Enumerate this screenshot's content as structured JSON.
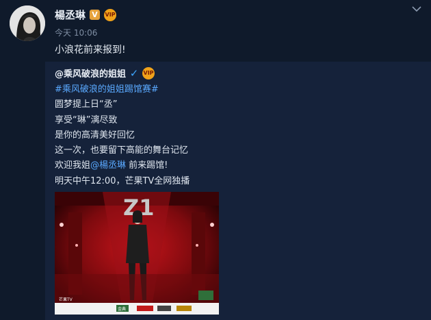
{
  "post": {
    "author": "楊丞琳",
    "timestamp": "今天 10:06",
    "text": "小浪花前来报到!",
    "badge_v": "V",
    "badge_round": "VIP"
  },
  "repost": {
    "author": "@乘风破浪的姐姐",
    "badge_v": "✓",
    "hashtag": "#乘风破浪的姐姐踢馆赛#",
    "lines": [
      "圆梦提上日“丞”",
      "享受“琳”漓尽致",
      "是你的高清美好回忆",
      "这一次，也要留下高能的舞台记忆"
    ],
    "welcome_prefix": "欢迎我姐",
    "welcome_mention": "@楊丞琳",
    "welcome_suffix": " 前来踢馆!",
    "schedule": "明天中午12:00，芒果TV全网独播"
  },
  "poster": {
    "logo_text": "Z1",
    "footer_items": [
      "芒果TV",
      "金典"
    ]
  },
  "colors": {
    "background": "#0f1a2b",
    "repost_bg": "#15223a",
    "link": "#5aa9ff",
    "badge_gold": "#e6a23c",
    "poster_red": "#b10d14"
  },
  "icons": {
    "chevron": "chevron-down-icon",
    "verified": "verified-icon"
  }
}
